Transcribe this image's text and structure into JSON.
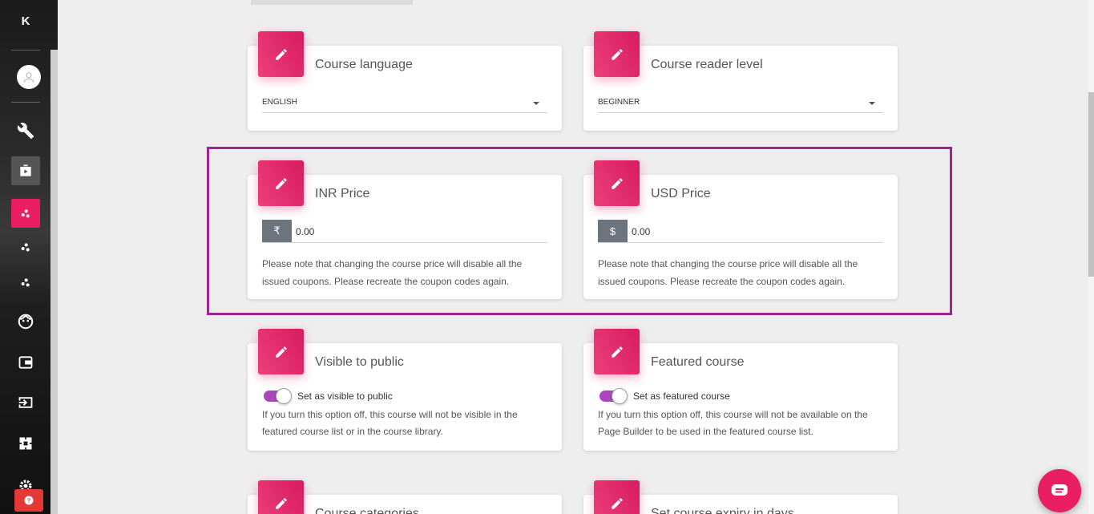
{
  "sidebar": {
    "logo": "K",
    "items": [
      {
        "icon": "wrench-icon"
      },
      {
        "icon": "video-library-icon"
      },
      {
        "icon": "bubble-chart-icon"
      },
      {
        "icon": "bubble-chart-icon"
      },
      {
        "icon": "bubble-chart-icon"
      },
      {
        "icon": "face-icon"
      },
      {
        "icon": "wallet-icon"
      },
      {
        "icon": "input-icon"
      },
      {
        "icon": "extension-icon"
      },
      {
        "icon": "settings-icon"
      }
    ],
    "help_icon": "help-icon"
  },
  "cards": {
    "language": {
      "title": "Course language",
      "value": "ENGLISH"
    },
    "reader_level": {
      "title": "Course reader level",
      "value": "BEGINNER"
    },
    "inr_price": {
      "title": "INR Price",
      "currency_symbol": "₹",
      "value": "0.00",
      "note": "Please note that changing the course price will disable all the issued coupons. Please recreate the coupon codes again."
    },
    "usd_price": {
      "title": "USD Price",
      "currency_symbol": "$",
      "value": "0.00",
      "note": "Please note that changing the course price will disable all the issued coupons. Please recreate the coupon codes again."
    },
    "visible": {
      "title": "Visible to public",
      "toggle_label": "Set as visible to public",
      "toggle_on": true,
      "note": "If you turn this option off, this course will not be visible in the featured course list or in the course library."
    },
    "featured": {
      "title": "Featured course",
      "toggle_label": "Set as featured course",
      "toggle_on": true,
      "note": "If you turn this option off, this course will not be available on the Page Builder to be used in the featured course list."
    },
    "categories": {
      "title": "Course categories"
    },
    "expiry": {
      "title": "Set course expiry in days"
    }
  },
  "colors": {
    "accent": "#e91e63",
    "highlight": "#a0248f",
    "toggle": "#ab47bc"
  }
}
